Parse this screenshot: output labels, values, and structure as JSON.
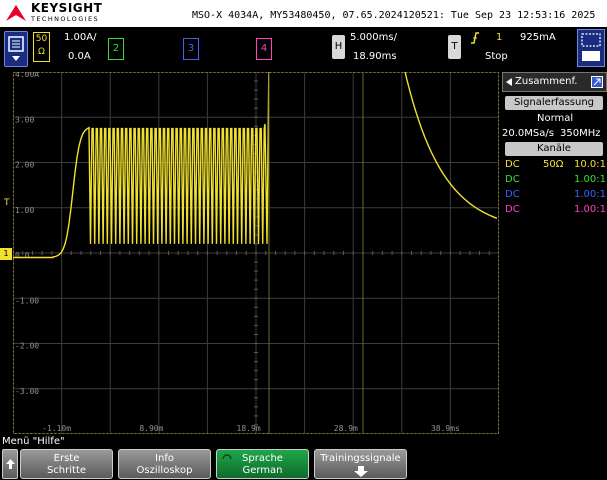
{
  "header": {
    "brand": "KEYSIGHT",
    "brand_sub": "TECHNOLOGIES",
    "instrument": "MSO-X 4034A, MY53480450, 07.65.2024120521: Tue Sep 23 12:53:16 2025"
  },
  "channels": {
    "ch1": {
      "label": "50 Ω",
      "scale": "1.00A/",
      "offset": "0.0A",
      "color": "#f0e030"
    },
    "ch2": {
      "label": "2",
      "color": "#30e030"
    },
    "ch3": {
      "label": "3",
      "color": "#4060ff"
    },
    "ch4": {
      "label": "4",
      "color": "#ff40c0"
    }
  },
  "horizontal": {
    "key": "H",
    "timebase": "5.000ms/",
    "delay": "18.90ms"
  },
  "trigger": {
    "key": "T",
    "source": "1",
    "level": "925mA",
    "status": "Stop"
  },
  "grid": {
    "y_labels": [
      "4.00A",
      "3.00",
      "2.00",
      "1.00",
      "0.0",
      "-1.00",
      "-2.00",
      "-3.00"
    ],
    "x_labels": [
      "-1.10m",
      "8.90m",
      "18.9m",
      "28.9m",
      "38.9ms"
    ]
  },
  "side_panel": {
    "title": "Zusammenf.",
    "acq_header": "Signalerfassung",
    "acq_mode": "Normal",
    "acq_rate": "20.0MSa/s",
    "acq_bw": "350MHz",
    "channels_header": "Kanäle",
    "rows": [
      {
        "coupling": "DC",
        "imp": "50Ω",
        "probe": "10.0:1",
        "color": "#f0e030"
      },
      {
        "coupling": "DC",
        "imp": "",
        "probe": "1.00:1",
        "color": "#30e030"
      },
      {
        "coupling": "DC",
        "imp": "",
        "probe": "1.00:1",
        "color": "#4060ff"
      },
      {
        "coupling": "DC",
        "imp": "",
        "probe": "1.00:1",
        "color": "#ff40c0"
      }
    ]
  },
  "menu": {
    "title": "Menü \"Hilfe\"",
    "keys": [
      {
        "line1": "Erste",
        "line2": "Schritte"
      },
      {
        "line1": "Info",
        "line2": "Oszilloskop"
      },
      {
        "line1": "Sprache",
        "line2": "German"
      },
      {
        "line1": "Trainingssignale",
        "line2": ""
      }
    ]
  }
}
